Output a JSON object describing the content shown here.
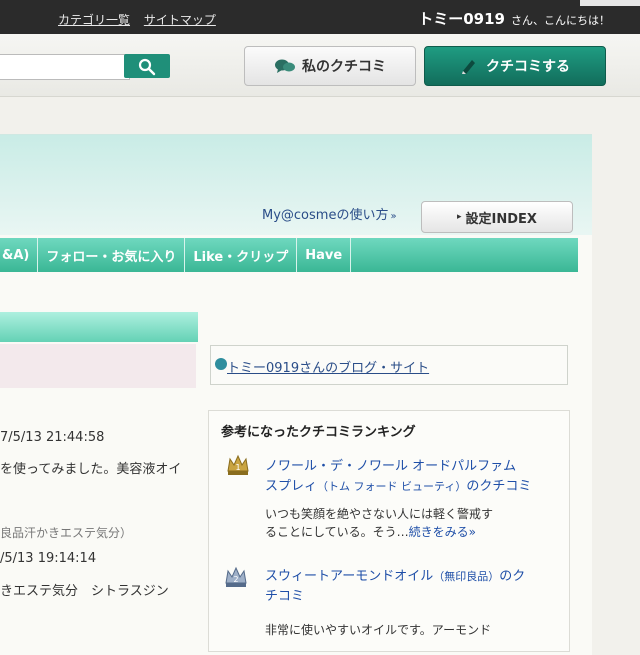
{
  "topbar": {
    "links": [
      "カテゴリ一覧",
      "サイトマップ"
    ],
    "user": "トミー0919",
    "greeting": "さん、こんにちは！"
  },
  "header": {
    "search_placeholder": "",
    "my_kuchikomi": "私のクチコミ",
    "post_kuchikomi": "クチコミする"
  },
  "main": {
    "help_link": "My@cosmeの使い方",
    "help_arrow": "»",
    "settings_button": "設定INDEX",
    "tabs": [
      "&A)",
      "フォロー・お気に入り",
      "Like・クリップ",
      "Have"
    ]
  },
  "left_column": {
    "items": [
      "7/5/13 21:44:58",
      "を使ってみました。美容液オイ",
      "良品汗かきエステ気分）",
      "/5/13 19:14:14",
      "きエステ気分　シトラスジン"
    ]
  },
  "right_column": {
    "blog_link": "トミー0919さんのブログ・サイト",
    "ranking_title": "参考になったクチコミランキング",
    "ranking": [
      {
        "rank": "1",
        "title_line1": "ノワール・デ・ノワール オードパルファム",
        "title_line2_main": "スプレィ",
        "title_line2_sub": "（トム フォード ビューティ）",
        "title_line2_end": "のクチコミ",
        "text_line1": "いつも笑顔を絶やさない人には軽く警戒す",
        "text_line2": "ることにしている。そう…",
        "more": "続きをみる",
        "more_arrow": "»"
      },
      {
        "rank": "2",
        "title_line1_main": "スウィートアーモンドオイル",
        "title_line1_sub": "（無印良品）",
        "title_line1_end": "のク",
        "title_line2": "チコミ",
        "text_line1": "非常に使いやすいオイルです。アーモンド"
      }
    ]
  },
  "colors": {
    "accent_green": "#1f8f79",
    "tab_green": "#3ab795",
    "link_blue": "#1f4fa8"
  }
}
